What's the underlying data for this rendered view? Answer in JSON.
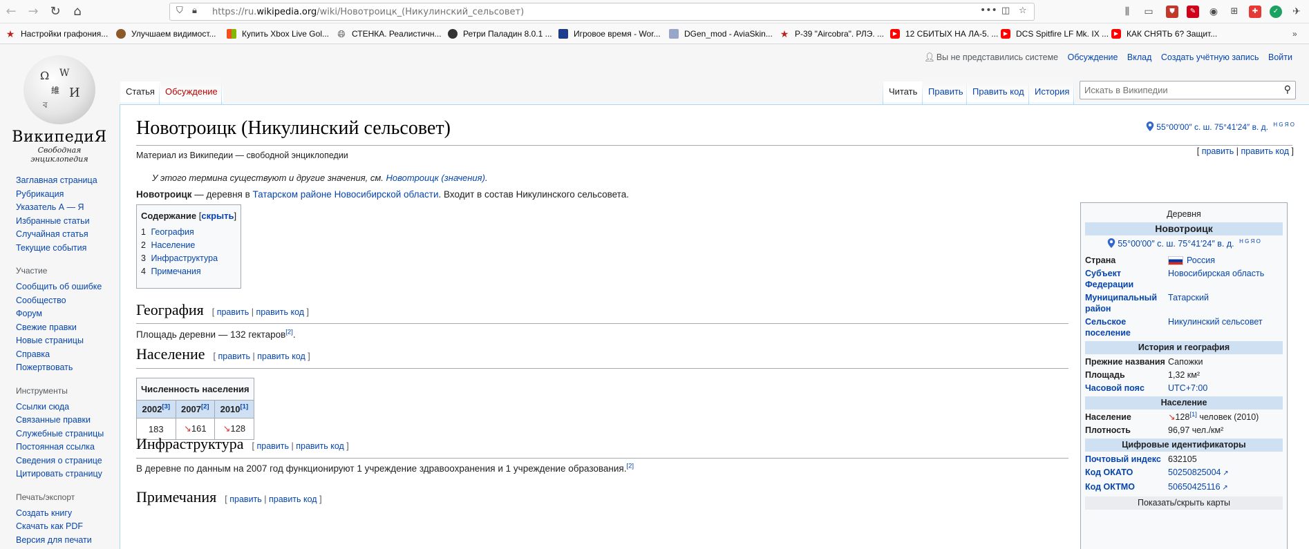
{
  "browser": {
    "url_prefix": "https://ru.",
    "url_host": "wikipedia.org",
    "url_path": "/wiki/Новотроицк_(Никулинский_сельсовет)",
    "bookmarks": [
      "Настройки графония...",
      "Улучшаем видимост...",
      "Купить Xbox Live Gol...",
      "СТЕНКА. Реалистичн...",
      "Ретри Паладин 8.0.1 ...",
      "Игровое время - Wor...",
      "DGen_mod - AviaSkin...",
      "P-39 \"Aircobra\". РЛЭ. ...",
      "12 СБИТЫХ НА ЛА-5. ...",
      "DCS Spitfire LF Mk. IX ...",
      "КАК СНЯТЬ 6? Защит..."
    ],
    "bookmark_icons": [
      "star-icon",
      "squirrel-icon",
      "windows-icon",
      "globe-icon",
      "paladin-icon",
      "game-icon",
      "aviaskin-icon",
      "star-icon",
      "youtube-icon",
      "youtube-icon",
      "youtube-icon"
    ]
  },
  "wiki": {
    "logo_word": "ВикипедиЯ",
    "logo_tagline": "Свободная энциклопедия",
    "personal": {
      "not_logged": "Вы не представились системе",
      "talk": "Обсуждение",
      "contribs": "Вклад",
      "create": "Создать учётную запись",
      "login": "Войти"
    },
    "tabs": {
      "article": "Статья",
      "discussion": "Обсуждение",
      "read": "Читать",
      "edit": "Править",
      "edit_source": "Править код",
      "history": "История"
    },
    "search_placeholder": "Искать в Википедии",
    "sidebar": {
      "nav": [
        "Заглавная страница",
        "Рубрикация",
        "Указатель А — Я",
        "Избранные статьи",
        "Случайная статья",
        "Текущие события"
      ],
      "participation_heading": "Участие",
      "participation": [
        "Сообщить об ошибке",
        "Сообщество",
        "Форум",
        "Свежие правки",
        "Новые страницы",
        "Справка",
        "Пожертвовать"
      ],
      "tools_heading": "Инструменты",
      "tools": [
        "Ссылки сюда",
        "Связанные правки",
        "Служебные страницы",
        "Постоянная ссылка",
        "Сведения о странице",
        "Цитировать страницу"
      ],
      "print_heading": "Печать/экспорт",
      "print": [
        "Создать книгу",
        "Скачать как PDF",
        "Версия для печати"
      ]
    },
    "article": {
      "title": "Новотроицк (Никулинский сельсовет)",
      "coords": "55°00′00″ с. ш. 75°41′24″ в. д.",
      "coord_links": "H G Я O",
      "site_sub": "Материал из Википедии — свободной энциклопедии",
      "edit_links": {
        "open": "[ ",
        "edit": "править",
        "sep": " | ",
        "edit_source": "править код",
        "close": " ]"
      },
      "hatnote_text": "У этого термина существуют и другие значения, см. ",
      "hatnote_link": "Новотроицк (значения)",
      "hatnote_end": ".",
      "lead_bold": "Новотроицк",
      "lead_1": " — деревня в ",
      "lead_link1": "Татарском районе",
      "lead_space": " ",
      "lead_link2": "Новосибирской области",
      "lead_2": ". Входит в состав Никулинского сельсовета.",
      "toc": {
        "title": "Содержание",
        "toggle": "скрыть",
        "items": [
          {
            "num": "1",
            "label": "География"
          },
          {
            "num": "2",
            "label": "Население"
          },
          {
            "num": "3",
            "label": "Инфраструктура"
          },
          {
            "num": "4",
            "label": "Примечания"
          }
        ]
      },
      "sections": {
        "geo_title": "География",
        "geo_text": "Площадь деревни — 132 гектаров",
        "geo_ref": "[2]",
        "geo_end": ".",
        "pop_title": "Население",
        "infra_title": "Инфраструктура",
        "infra_text": "В деревне по данным на 2007 год функционируют 1 учреждение здравоохранения и 1 учреждение образования.",
        "infra_ref": "[2]",
        "notes_title": "Примечания"
      },
      "population_table": {
        "caption": "Численность населения",
        "years": [
          {
            "year": "2002",
            "ref": "[3]"
          },
          {
            "year": "2007",
            "ref": "[2]"
          },
          {
            "year": "2010",
            "ref": "[1]"
          }
        ],
        "values": [
          {
            "arrow": "",
            "value": "183"
          },
          {
            "arrow": "↘",
            "value": "161"
          },
          {
            "arrow": "↘",
            "value": "128"
          }
        ]
      }
    },
    "infobox": {
      "type": "Деревня",
      "name": "Новотроицк",
      "coords": "55°00′00″ с. ш. 75°41′24″ в. д.",
      "coord_links": "H G Я O",
      "country_label": "Страна",
      "country": "Россия",
      "subject_label": "Субъект Федерации",
      "subject": "Новосибирская область",
      "district_label": "Муниципальный район",
      "district": "Татарский",
      "settlement_label": "Сельское поселение",
      "settlement": "Никулинский сельсовет",
      "history_heading": "История и география",
      "former_label": "Прежние названия",
      "former": "Сапожки",
      "area_label": "Площадь",
      "area": "1,32 км²",
      "tz_label": "Часовой пояс",
      "tz": "UTC+7:00",
      "pop_heading": "Население",
      "pop_label": "Население",
      "pop_arrow": "↘",
      "pop_value": "128",
      "pop_ref": "[1]",
      "pop_unit": " человек (2010)",
      "density_label": "Плотность",
      "density": "96,97 чел./км²",
      "ids_heading": "Цифровые идентификаторы",
      "postal_label": "Почтовый индекс",
      "postal": "632105",
      "okato_label": "Код ОКАТО",
      "okato": "50250825004",
      "oktmo_label": "Код ОКТМО",
      "oktmo": "50650425116",
      "map_toggle": "Показать/скрыть карты"
    }
  }
}
